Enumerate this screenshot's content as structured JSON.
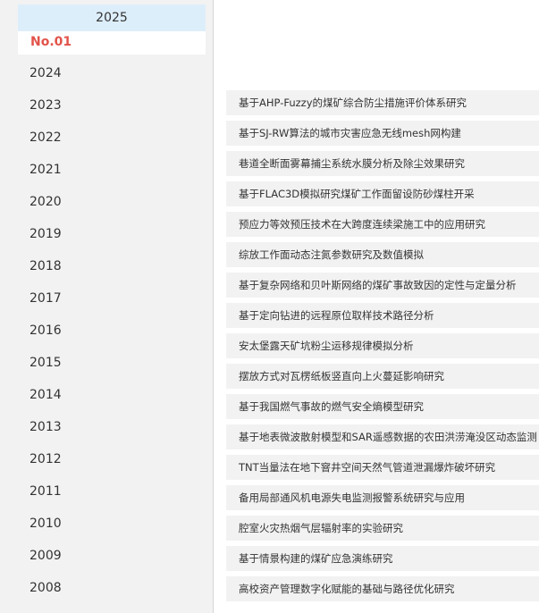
{
  "sidebar": {
    "active_year": "2025",
    "active_issue": "No.01",
    "years": [
      "2024",
      "2023",
      "2022",
      "2021",
      "2020",
      "2019",
      "2018",
      "2017",
      "2016",
      "2015",
      "2014",
      "2013",
      "2012",
      "2011",
      "2010",
      "2009",
      "2008"
    ]
  },
  "articles": [
    "基于AHP-Fuzzy的煤矿综合防尘措施评价体系研究",
    "基于SJ-RW算法的城市灾害应急无线mesh网构建",
    "巷道全断面雾幕捕尘系统水膜分析及除尘效果研究",
    "基于FLAC3D模拟研究煤矿工作面留设防砂煤柱开采",
    "预应力等效预压技术在大跨度连续梁施工中的应用研究",
    "综放工作面动态注氮参数研究及数值模拟",
    "基于复杂网络和贝叶斯网络的煤矿事故致因的定性与定量分析",
    "基于定向钻进的远程原位取样技术路径分析",
    "安太堡露天矿坑粉尘运移规律模拟分析",
    "摆放方式对瓦楞纸板竖直向上火蔓延影响研究",
    "基于我国燃气事故的燃气安全熵模型研究",
    "基于地表微波散射模型和SAR遥感数据的农田洪涝淹没区动态监测",
    "TNT当量法在地下窨井空间天然气管道泄漏爆炸破坏研究",
    "备用局部通风机电源失电监测报警系统研究与应用",
    "腔室火灾热烟气层辐射率的实验研究",
    "基于情景构建的煤矿应急演练研究",
    "高校资产管理数字化赋能的基础与路径优化研究"
  ]
}
